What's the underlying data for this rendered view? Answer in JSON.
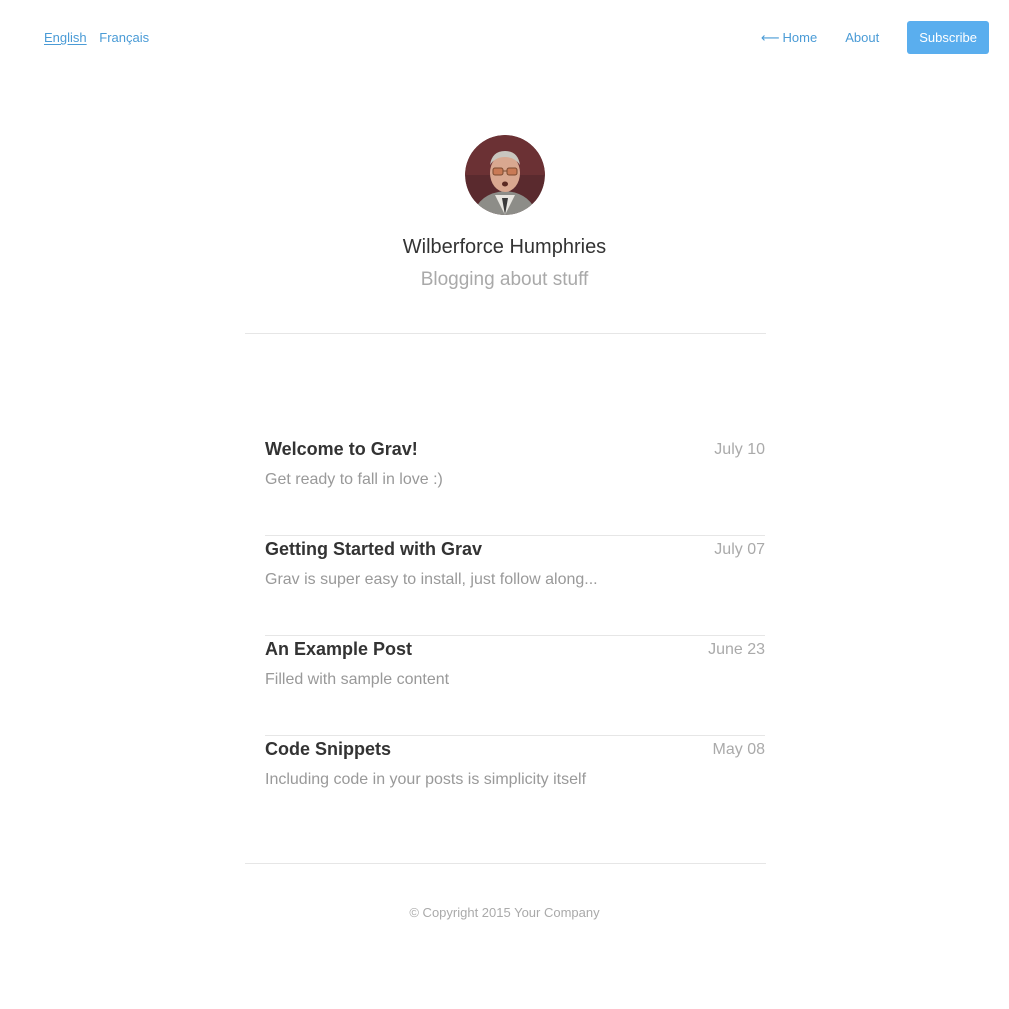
{
  "languages": [
    {
      "label": "English",
      "active": true
    },
    {
      "label": "Français",
      "active": false
    }
  ],
  "nav": {
    "home_arrow": "⟵",
    "home_label": "Home",
    "about_label": "About",
    "subscribe_label": "Subscribe"
  },
  "profile": {
    "name": "Wilberforce Humphries",
    "tagline": "Blogging about stuff"
  },
  "posts": [
    {
      "title": "Welcome to Grav!",
      "date": "July 10",
      "summary": "Get ready to fall in love :)"
    },
    {
      "title": "Getting Started with Grav",
      "date": "July 07",
      "summary": "Grav is super easy to install, just follow along..."
    },
    {
      "title": "An Example Post",
      "date": "June 23",
      "summary": "Filled with sample content"
    },
    {
      "title": "Code Snippets",
      "date": "May 08",
      "summary": "Including code in your posts is simplicity itself"
    }
  ],
  "footer": {
    "copyright": "© Copyright 2015 Your Company"
  },
  "colors": {
    "link": "#4a9bd6",
    "subscribe_bg": "#5aaeee",
    "title": "#333333",
    "muted": "#aaaaaa"
  }
}
